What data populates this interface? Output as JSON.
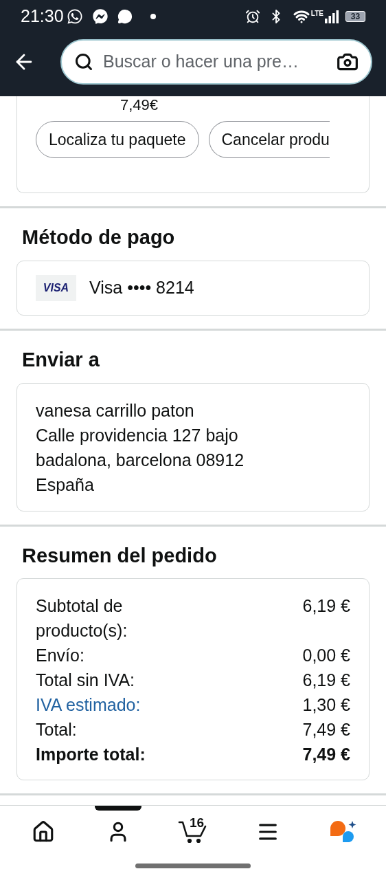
{
  "status_bar": {
    "time": "21:30",
    "network": "LTE",
    "battery": "33"
  },
  "header": {
    "search": {
      "placeholder": "Buscar o hacer una pre…"
    }
  },
  "order_card": {
    "price": "7,49€",
    "buttons": [
      "Localiza tu paquete",
      "Cancelar produ"
    ]
  },
  "payment": {
    "title": "Método de pago",
    "card_brand": "VISA",
    "card_text": "Visa •••• 8214"
  },
  "shipping": {
    "title": "Enviar a",
    "address_lines": [
      "vanesa carrillo paton",
      "Calle providencia 127 bajo",
      "badalona, barcelona 08912",
      "España"
    ]
  },
  "summary": {
    "title": "Resumen del pedido",
    "rows": [
      {
        "kind": "normal",
        "label": "Subtotal de producto(s):",
        "value": "6,19 €"
      },
      {
        "kind": "normal",
        "label": "Envío:",
        "value": "0,00 €"
      },
      {
        "kind": "normal",
        "label": "Total sin IVA:",
        "value": "6,19 €"
      },
      {
        "kind": "link",
        "label": "IVA estimado:",
        "value": "1,30 €"
      },
      {
        "kind": "normal",
        "label": "Total:",
        "value": "7,49 €"
      },
      {
        "kind": "bold",
        "label": "Importe total:",
        "value": "7,49 €"
      }
    ]
  },
  "bottom_nav": [
    {
      "kind": "home",
      "selected": false
    },
    {
      "kind": "account",
      "selected": true
    },
    {
      "kind": "cart",
      "selected": false,
      "badge": "16"
    },
    {
      "kind": "menu",
      "selected": false
    },
    {
      "kind": "assistant",
      "selected": false
    }
  ]
}
